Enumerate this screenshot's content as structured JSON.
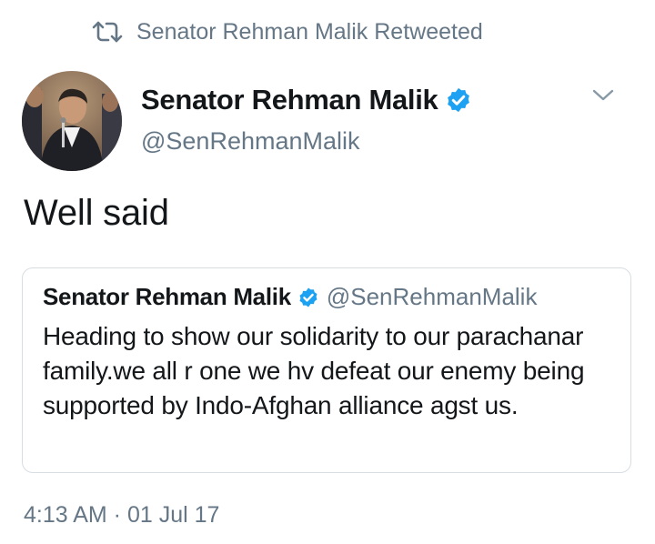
{
  "retweet": {
    "label": "Senator Rehman Malik Retweeted",
    "icon": "retweet-icon"
  },
  "tweet": {
    "author_name": "Senator Rehman Malik",
    "author_handle": "@SenRehmanMalik",
    "verified_icon": "verified-badge-icon",
    "menu_icon": "chevron-down-icon",
    "text": "Well said",
    "timestamp": "4:13 AM · 01 Jul 17"
  },
  "quoted_tweet": {
    "author_name": "Senator Rehman Malik",
    "author_handle": "@SenRehmanMalik",
    "text": "Heading to show our solidarity to our parachanar family.we all r one we hv defeat our enemy being supported by Indo-Afghan alliance agst us."
  },
  "colors": {
    "verified": "#1da1f2",
    "secondary_text": "#657786",
    "primary_text": "#14171a",
    "border": "#d7dde2"
  }
}
